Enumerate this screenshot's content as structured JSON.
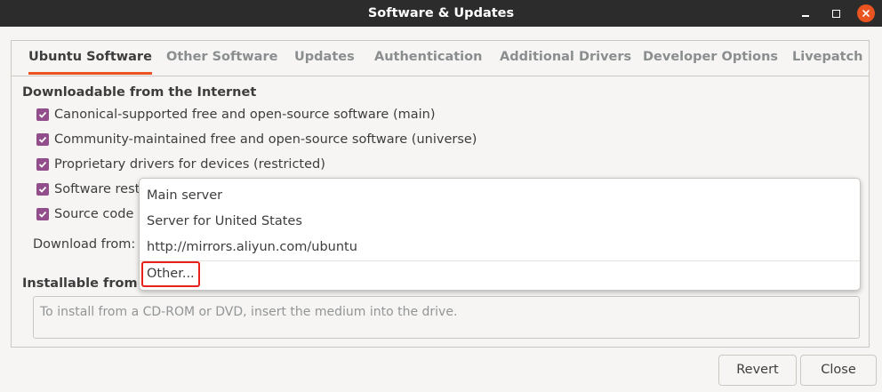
{
  "window": {
    "title": "Software & Updates"
  },
  "tabs": [
    {
      "label": "Ubuntu Software",
      "active": true
    },
    {
      "label": "Other Software",
      "active": false
    },
    {
      "label": "Updates",
      "active": false
    },
    {
      "label": "Authentication",
      "active": false
    },
    {
      "label": "Additional Drivers",
      "active": false
    },
    {
      "label": "Developer Options",
      "active": false
    },
    {
      "label": "Livepatch",
      "active": false
    }
  ],
  "downloadable": {
    "heading": "Downloadable from the Internet",
    "items": [
      {
        "label": "Canonical-supported free and open-source software (main)",
        "checked": true
      },
      {
        "label": "Community-maintained free and open-source software (universe)",
        "checked": true
      },
      {
        "label": "Proprietary drivers for devices (restricted)",
        "checked": true
      },
      {
        "label": "Software restr",
        "checked": true
      },
      {
        "label": "Source code",
        "checked": true
      }
    ],
    "download_from_label": "Download from:"
  },
  "installable": {
    "heading": "Installable from CD",
    "cd_hint": "To install from a CD-ROM or DVD, insert the medium into the drive."
  },
  "server_menu": {
    "options": [
      "Main server",
      "Server for United States",
      "http://mirrors.aliyun.com/ubuntu"
    ],
    "other": "Other..."
  },
  "buttons": {
    "revert": "Revert",
    "close": "Close"
  },
  "colors": {
    "accent": "#e95420",
    "checkbox": "#924d8b",
    "highlight_box": "#e8211b",
    "titlebar": "#2c2c2c"
  }
}
